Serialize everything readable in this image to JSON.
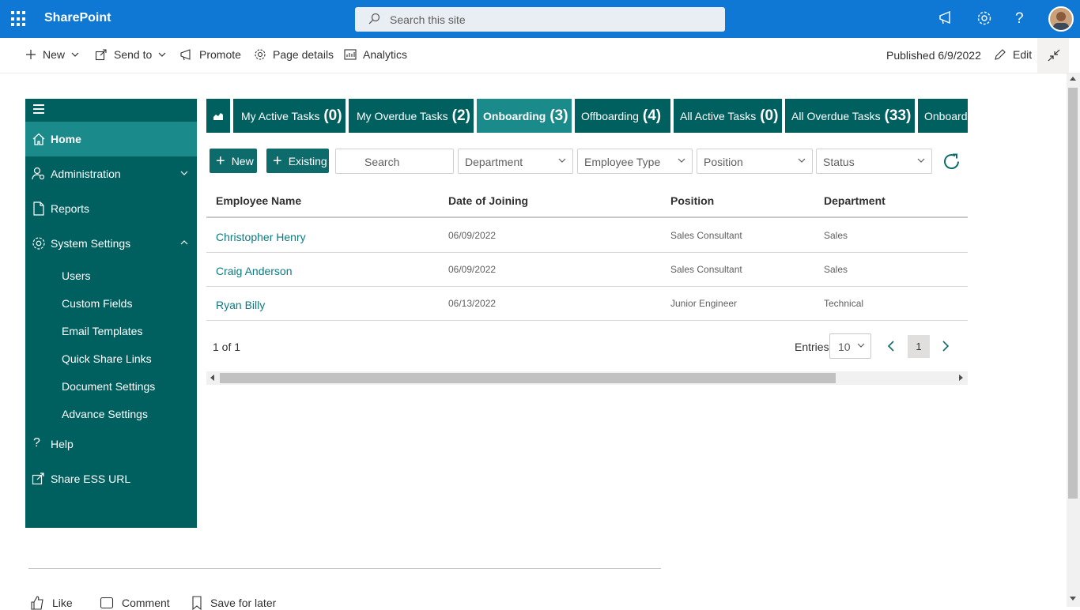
{
  "suite": {
    "brand": "SharePoint",
    "search_placeholder": "Search this site"
  },
  "commandbar": {
    "new": "New",
    "send_to": "Send to",
    "promote": "Promote",
    "page_details": "Page details",
    "analytics": "Analytics",
    "published": "Published 6/9/2022",
    "edit": "Edit"
  },
  "sidebar": {
    "items": [
      {
        "label": "Home",
        "icon": "home-icon"
      },
      {
        "label": "Administration",
        "icon": "admin-icon"
      },
      {
        "label": "Reports",
        "icon": "document-icon"
      },
      {
        "label": "System Settings",
        "icon": "gear-icon"
      }
    ],
    "sub_items": [
      "Users",
      "Custom Fields",
      "Email Templates",
      "Quick Share Links",
      "Document Settings",
      "Advance Settings"
    ],
    "bottom_items": [
      {
        "label": "Help",
        "icon": "question-icon"
      },
      {
        "label": "Share ESS URL",
        "icon": "share-icon"
      }
    ]
  },
  "tabs": [
    {
      "label": "My Active Tasks",
      "count": "(0)"
    },
    {
      "label": "My Overdue Tasks",
      "count": "(2)"
    },
    {
      "label": "Onboarding",
      "count": "(3)"
    },
    {
      "label": "Offboarding",
      "count": "(4)"
    },
    {
      "label": "All Active Tasks",
      "count": "(0)"
    },
    {
      "label": "All Overdue Tasks",
      "count": "(33)"
    },
    {
      "label": "Onboarding",
      "count": ""
    }
  ],
  "toolbar": {
    "new": "New",
    "existing": "Existing",
    "search_placeholder": "Search",
    "department": "Department",
    "employee_type": "Employee Type",
    "position": "Position",
    "status": "Status"
  },
  "table": {
    "columns": [
      "Employee Name",
      "Date of Joining",
      "Position",
      "Department"
    ],
    "rows": [
      {
        "name": "Christopher Henry",
        "date": "06/09/2022",
        "position": "Sales Consultant",
        "department": "Sales"
      },
      {
        "name": "Craig Anderson",
        "date": "06/09/2022",
        "position": "Sales Consultant",
        "department": "Sales"
      },
      {
        "name": "Ryan Billy",
        "date": "06/13/2022",
        "position": "Junior Engineer",
        "department": "Technical"
      }
    ]
  },
  "pager": {
    "summary": "1 of 1",
    "entries_label": "Entries",
    "entries_value": "10",
    "current_page": "1"
  },
  "footer": {
    "like": "Like",
    "comment": "Comment",
    "save": "Save for later"
  },
  "colors": {
    "suite_blue": "#0f78d4",
    "nav_teal": "#005f5f",
    "active_teal": "#1a8a8a",
    "link_teal": "#0a7b83"
  }
}
